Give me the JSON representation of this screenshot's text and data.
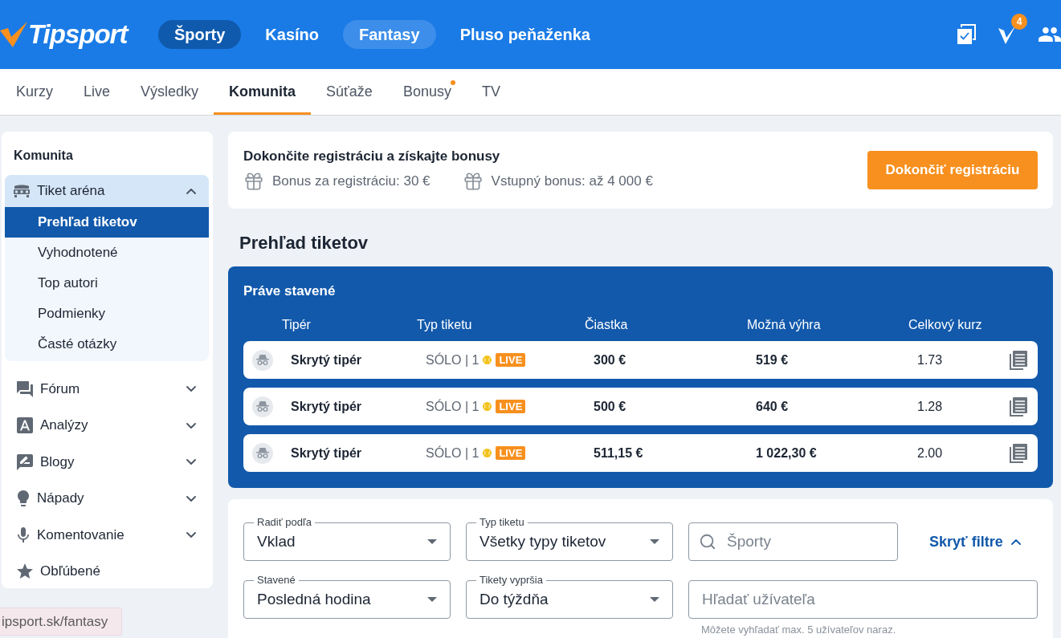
{
  "header": {
    "logo": "Tipsport",
    "nav": [
      {
        "label": "Športy",
        "selected": true,
        "hovered": false
      },
      {
        "label": "Kasíno",
        "selected": false,
        "hovered": false
      },
      {
        "label": "Fantasy",
        "selected": false,
        "hovered": true
      },
      {
        "label": "Pluso peňaženka",
        "selected": false,
        "hovered": false
      }
    ],
    "badge": "4"
  },
  "subnav": {
    "tabs": [
      {
        "label": "Kurzy",
        "selected": false,
        "dot": false
      },
      {
        "label": "Live",
        "selected": false,
        "dot": false
      },
      {
        "label": "Výsledky",
        "selected": false,
        "dot": false
      },
      {
        "label": "Komunita",
        "selected": true,
        "dot": false
      },
      {
        "label": "Súťaže",
        "selected": false,
        "dot": false
      },
      {
        "label": "Bonusy",
        "selected": false,
        "dot": true
      },
      {
        "label": "TV",
        "selected": false,
        "dot": false
      }
    ]
  },
  "sidebar": {
    "title": "Komunita",
    "items": [
      {
        "kind": "group",
        "label": "Tiket aréna",
        "expanded": true,
        "children": [
          {
            "label": "Prehľad tiketov",
            "selected": true
          },
          {
            "label": "Vyhodnotené",
            "selected": false
          },
          {
            "label": "Top autori",
            "selected": false
          },
          {
            "label": "Podmienky",
            "selected": false
          },
          {
            "label": "Časté otázky",
            "selected": false
          }
        ]
      },
      {
        "kind": "group",
        "label": "Fórum",
        "expanded": false
      },
      {
        "kind": "group",
        "label": "Analýzy",
        "expanded": false
      },
      {
        "kind": "group",
        "label": "Blogy",
        "expanded": false
      },
      {
        "kind": "group",
        "label": "Nápady",
        "expanded": false
      },
      {
        "kind": "group",
        "label": "Komentovanie",
        "expanded": false
      },
      {
        "kind": "link",
        "label": "Obľúbené"
      }
    ]
  },
  "registration": {
    "title": "Dokončite registráciu a získajte bonusy",
    "bonuses": [
      "Bonus za registráciu: 30 €",
      "Vstupný bonus: až 4 000 €"
    ],
    "button": "Dokončiť registráciu"
  },
  "page_title": "Prehľad tiketov",
  "tickets": {
    "title": "Práve stavené",
    "columns": [
      "Tipér",
      "Typ tiketu",
      "Čiastka",
      "Možná výhra",
      "Celkový kurz"
    ],
    "rows": [
      {
        "tipper": "Skrytý tipér",
        "type": "SÓLO | 1",
        "badge": "LIVE",
        "amount": "300 €",
        "win": "519 €",
        "odds": "1.73"
      },
      {
        "tipper": "Skrytý tipér",
        "type": "SÓLO | 1",
        "badge": "LIVE",
        "amount": "500 €",
        "win": "640 €",
        "odds": "1.28"
      },
      {
        "tipper": "Skrytý tipér",
        "type": "SÓLO | 1",
        "badge": "LIVE",
        "amount": "511,15 €",
        "win": "1 022,30 €",
        "odds": "2.00"
      }
    ]
  },
  "filters": {
    "selects": [
      {
        "label": "Radiť podľa",
        "value": "Vklad"
      },
      {
        "label": "Typ tiketu",
        "value": "Všetky typy tiketov"
      },
      {
        "label": "Stavené",
        "value": "Posledná hodina"
      },
      {
        "label": "Tikety vypršia",
        "value": "Do týždňa"
      }
    ],
    "sport_search": {
      "placeholder": "Športy"
    },
    "toggle": "Skryť filtre",
    "user_search": {
      "placeholder": "Hľadať užívateľa",
      "hint": "Môžete vyhľadať max. 5 užívateľov naraz."
    }
  },
  "status_bar": {
    "url": "ipsport.sk/fantasy"
  }
}
